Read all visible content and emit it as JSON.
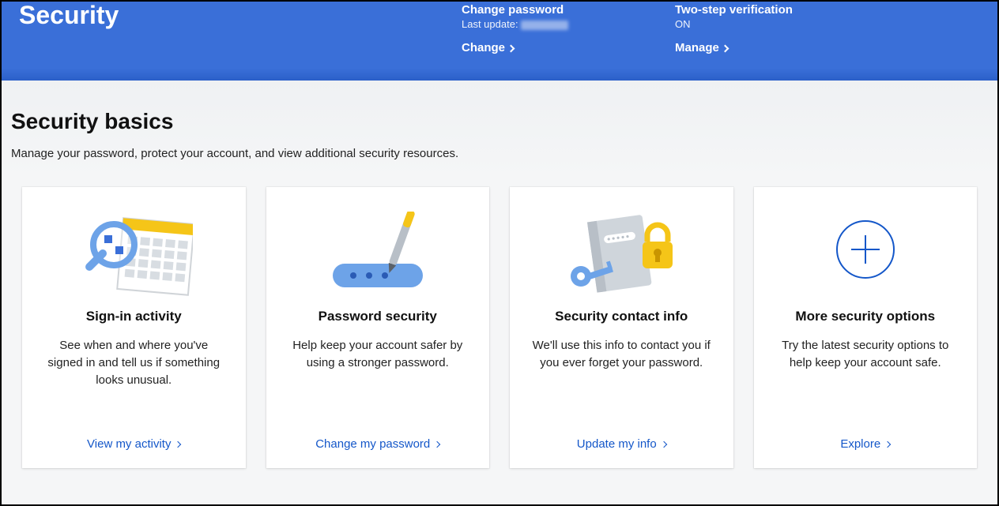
{
  "header": {
    "title": "Security",
    "password": {
      "title": "Change password",
      "sub_prefix": "Last update:",
      "action": "Change"
    },
    "twostep": {
      "title": "Two-step verification",
      "status": "ON",
      "action": "Manage"
    }
  },
  "section": {
    "title": "Security basics",
    "subtitle": "Manage your password, protect your account, and view additional security resources."
  },
  "cards": [
    {
      "title": "Sign-in activity",
      "desc": "See when and where you've signed in and tell us if something looks unusual.",
      "link": "View my activity"
    },
    {
      "title": "Password security",
      "desc": "Help keep your account safer by using a stronger password.",
      "link": "Change my password"
    },
    {
      "title": "Security contact info",
      "desc": "We'll use this info to contact you if you ever forget your password.",
      "link": "Update my info"
    },
    {
      "title": "More security options",
      "desc": "Try the latest security options to help keep your account safe.",
      "link": "Explore"
    }
  ]
}
